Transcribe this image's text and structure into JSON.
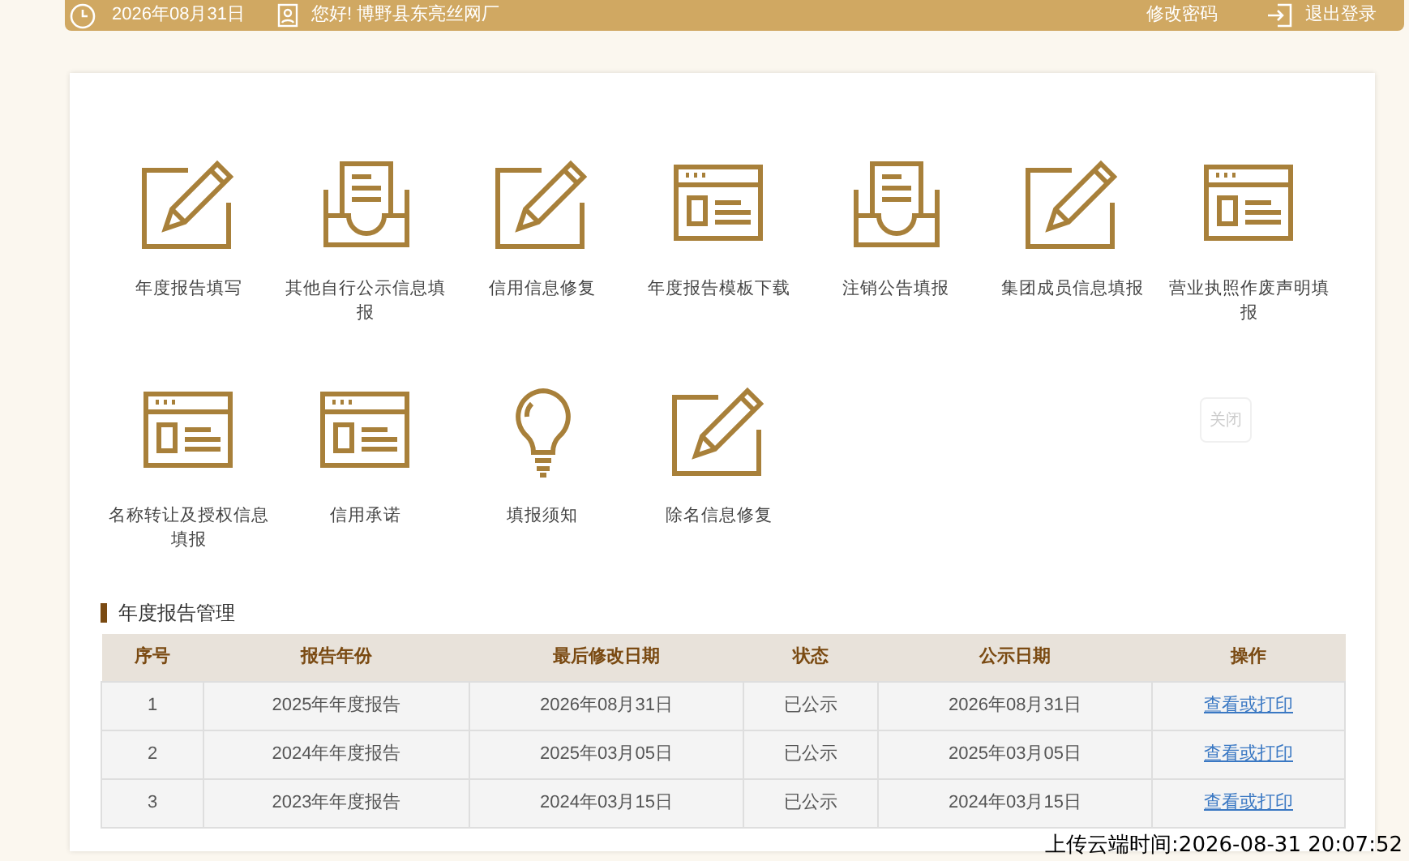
{
  "top_bar": {
    "date": "2026年08月31日",
    "greeting": "您好! 博野县东亮丝网厂",
    "change_password": "修改密码",
    "logout": "退出登录"
  },
  "menu": [
    {
      "kind": "pencil",
      "label": "年度报告填写"
    },
    {
      "kind": "inbox",
      "label": "其他自行公示信息填报"
    },
    {
      "kind": "pencil",
      "label": "信用信息修复"
    },
    {
      "kind": "window",
      "label": "年度报告模板下载"
    },
    {
      "kind": "inbox",
      "label": "注销公告填报"
    },
    {
      "kind": "pencil",
      "label": "集团成员信息填报"
    },
    {
      "kind": "window",
      "label": "营业执照作废声明填报"
    },
    {
      "kind": "window",
      "label": "名称转让及授权信息填报"
    },
    {
      "kind": "window",
      "label": "信用承诺"
    },
    {
      "kind": "bulb",
      "label": "填报须知"
    },
    {
      "kind": "pencil",
      "label": "除名信息修复"
    }
  ],
  "close_button": "关闭",
  "section_title": "年度报告管理",
  "table": {
    "columns": [
      "序号",
      "报告年份",
      "最后修改日期",
      "状态",
      "公示日期",
      "操作"
    ],
    "rows": [
      [
        "1",
        "2025年年度报告",
        "2026年08月31日",
        "已公示",
        "2026年08月31日",
        "查看或打印"
      ],
      [
        "2",
        "2024年年度报告",
        "2025年03月05日",
        "已公示",
        "2025年03月05日",
        "查看或打印"
      ],
      [
        "3",
        "2023年年度报告",
        "2024年03月15日",
        "已公示",
        "2024年03月15日",
        "查看或打印"
      ]
    ]
  },
  "upload_timestamp": "上传云端时间:2026-08-31 20:07:52"
}
